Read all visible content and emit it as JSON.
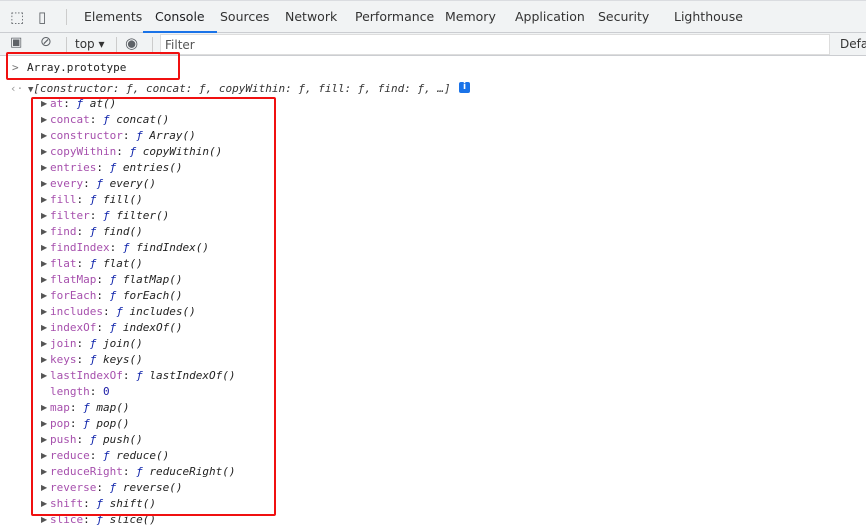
{
  "tabs": [
    "Elements",
    "Console",
    "Sources",
    "Network",
    "Performance",
    "Memory",
    "Application",
    "Security",
    "Lighthouse"
  ],
  "active_tab": "Console",
  "toolbar": {
    "context": "top",
    "filter_placeholder": "Filter",
    "levels": "Defa"
  },
  "input": {
    "prompt": ">",
    "command": "Array.prototype"
  },
  "output": {
    "summary": "[constructor: ƒ, concat: ƒ, copyWithin: ƒ, fill: ƒ, find: ƒ, …]",
    "properties": [
      {
        "key": "at",
        "value": "at()"
      },
      {
        "key": "concat",
        "value": "concat()"
      },
      {
        "key": "constructor",
        "value": "Array()"
      },
      {
        "key": "copyWithin",
        "value": "copyWithin()"
      },
      {
        "key": "entries",
        "value": "entries()"
      },
      {
        "key": "every",
        "value": "every()"
      },
      {
        "key": "fill",
        "value": "fill()"
      },
      {
        "key": "filter",
        "value": "filter()"
      },
      {
        "key": "find",
        "value": "find()"
      },
      {
        "key": "findIndex",
        "value": "findIndex()"
      },
      {
        "key": "flat",
        "value": "flat()"
      },
      {
        "key": "flatMap",
        "value": "flatMap()"
      },
      {
        "key": "forEach",
        "value": "forEach()"
      },
      {
        "key": "includes",
        "value": "includes()"
      },
      {
        "key": "indexOf",
        "value": "indexOf()"
      },
      {
        "key": "join",
        "value": "join()"
      },
      {
        "key": "keys",
        "value": "keys()"
      },
      {
        "key": "lastIndexOf",
        "value": "lastIndexOf()"
      },
      {
        "key": "length",
        "value": "0",
        "plain": true
      },
      {
        "key": "map",
        "value": "map()"
      },
      {
        "key": "pop",
        "value": "pop()"
      },
      {
        "key": "push",
        "value": "push()"
      },
      {
        "key": "reduce",
        "value": "reduce()"
      },
      {
        "key": "reduceRight",
        "value": "reduceRight()"
      },
      {
        "key": "reverse",
        "value": "reverse()"
      },
      {
        "key": "shift",
        "value": "shift()"
      },
      {
        "key": "slice",
        "value": "slice()"
      }
    ]
  },
  "colors": {
    "highlight": "#f01010",
    "accent": "#1a73e8"
  }
}
